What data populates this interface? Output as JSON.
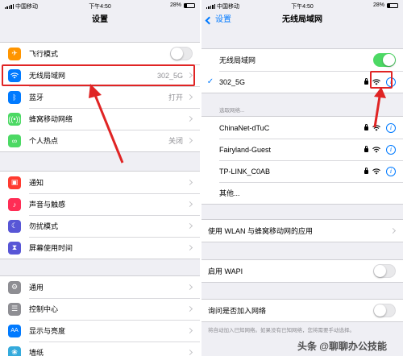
{
  "left": {
    "status": {
      "carrier": "中国移动",
      "time": "下午4:50",
      "battery": "28%"
    },
    "title": "设置",
    "group1": [
      {
        "label": "飞行模式",
        "icon": "airplane-icon",
        "color": "#ff9500",
        "toggle": false
      },
      {
        "label": "无线局域网",
        "icon": "wifi-icon",
        "color": "#007aff",
        "value": "302_5G"
      },
      {
        "label": "蓝牙",
        "icon": "bluetooth-icon",
        "color": "#007aff",
        "value": "打开"
      },
      {
        "label": "蜂窝移动网络",
        "icon": "cellular-icon",
        "color": "#4cd964",
        "value": ""
      },
      {
        "label": "个人热点",
        "icon": "hotspot-icon",
        "color": "#4cd964",
        "value": "关闭"
      }
    ],
    "group2": [
      {
        "label": "通知",
        "icon": "notifications-icon",
        "color": "#ff3b30"
      },
      {
        "label": "声音与触感",
        "icon": "sounds-icon",
        "color": "#ff2d55"
      },
      {
        "label": "勿扰模式",
        "icon": "moon-icon",
        "color": "#5856d6"
      },
      {
        "label": "屏幕使用时间",
        "icon": "hourglass-icon",
        "color": "#5856d6"
      }
    ],
    "group3": [
      {
        "label": "通用",
        "icon": "gear-icon",
        "color": "#8e8e93"
      },
      {
        "label": "控制中心",
        "icon": "control-center-icon",
        "color": "#8e8e93"
      },
      {
        "label": "显示与亮度",
        "icon": "display-icon",
        "color": "#007aff"
      },
      {
        "label": "墙纸",
        "icon": "wallpaper-icon",
        "color": "#34aadc"
      }
    ]
  },
  "right": {
    "status": {
      "carrier": "中国移动",
      "time": "下午4:50",
      "battery": "28%"
    },
    "back_label": "设置",
    "title": "无线局域网",
    "wlan_label": "无线局域网",
    "wlan_on": true,
    "connected": {
      "name": "302_5G",
      "check": "✓"
    },
    "choose_header": "选取网络...",
    "networks": [
      {
        "name": "ChinaNet-dTuC",
        "locked": true
      },
      {
        "name": "Fairyland-Guest",
        "locked": true
      },
      {
        "name": "TP-LINK_C0AB",
        "locked": true
      },
      {
        "name": "其他...",
        "locked": false
      }
    ],
    "apps_label": "使用 WLAN 与蜂窝移动网的应用",
    "wapi_label": "启用 WAPI",
    "wapi_on": false,
    "ask_label": "询问是否加入网络",
    "ask_on": false,
    "footnote": "将自动加入已知网络。如果没有已知网络，您将需要手动选择。"
  },
  "watermark": "头条 @聊聊办公技能",
  "colors": {
    "accent": "#007aff",
    "toggle_on": "#4cd964",
    "highlight": "#e02424"
  }
}
